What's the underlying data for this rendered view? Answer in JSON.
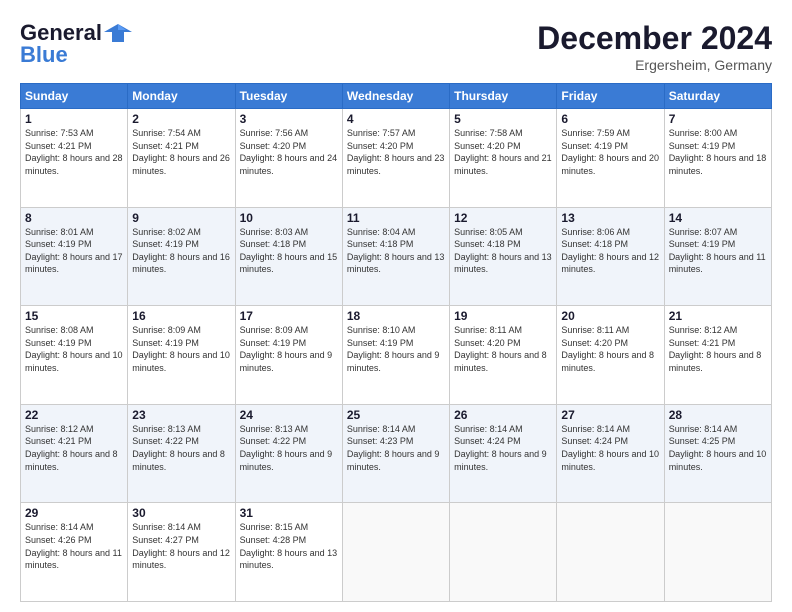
{
  "header": {
    "logo_line1": "General",
    "logo_line2": "Blue",
    "month_title": "December 2024",
    "location": "Ergersheim, Germany"
  },
  "days_of_week": [
    "Sunday",
    "Monday",
    "Tuesday",
    "Wednesday",
    "Thursday",
    "Friday",
    "Saturday"
  ],
  "weeks": [
    [
      {
        "day": "1",
        "sunrise": "7:53 AM",
        "sunset": "4:21 PM",
        "daylight": "8 hours and 28 minutes."
      },
      {
        "day": "2",
        "sunrise": "7:54 AM",
        "sunset": "4:21 PM",
        "daylight": "8 hours and 26 minutes."
      },
      {
        "day": "3",
        "sunrise": "7:56 AM",
        "sunset": "4:20 PM",
        "daylight": "8 hours and 24 minutes."
      },
      {
        "day": "4",
        "sunrise": "7:57 AM",
        "sunset": "4:20 PM",
        "daylight": "8 hours and 23 minutes."
      },
      {
        "day": "5",
        "sunrise": "7:58 AM",
        "sunset": "4:20 PM",
        "daylight": "8 hours and 21 minutes."
      },
      {
        "day": "6",
        "sunrise": "7:59 AM",
        "sunset": "4:19 PM",
        "daylight": "8 hours and 20 minutes."
      },
      {
        "day": "7",
        "sunrise": "8:00 AM",
        "sunset": "4:19 PM",
        "daylight": "8 hours and 18 minutes."
      }
    ],
    [
      {
        "day": "8",
        "sunrise": "8:01 AM",
        "sunset": "4:19 PM",
        "daylight": "8 hours and 17 minutes."
      },
      {
        "day": "9",
        "sunrise": "8:02 AM",
        "sunset": "4:19 PM",
        "daylight": "8 hours and 16 minutes."
      },
      {
        "day": "10",
        "sunrise": "8:03 AM",
        "sunset": "4:18 PM",
        "daylight": "8 hours and 15 minutes."
      },
      {
        "day": "11",
        "sunrise": "8:04 AM",
        "sunset": "4:18 PM",
        "daylight": "8 hours and 13 minutes."
      },
      {
        "day": "12",
        "sunrise": "8:05 AM",
        "sunset": "4:18 PM",
        "daylight": "8 hours and 13 minutes."
      },
      {
        "day": "13",
        "sunrise": "8:06 AM",
        "sunset": "4:18 PM",
        "daylight": "8 hours and 12 minutes."
      },
      {
        "day": "14",
        "sunrise": "8:07 AM",
        "sunset": "4:19 PM",
        "daylight": "8 hours and 11 minutes."
      }
    ],
    [
      {
        "day": "15",
        "sunrise": "8:08 AM",
        "sunset": "4:19 PM",
        "daylight": "8 hours and 10 minutes."
      },
      {
        "day": "16",
        "sunrise": "8:09 AM",
        "sunset": "4:19 PM",
        "daylight": "8 hours and 10 minutes."
      },
      {
        "day": "17",
        "sunrise": "8:09 AM",
        "sunset": "4:19 PM",
        "daylight": "8 hours and 9 minutes."
      },
      {
        "day": "18",
        "sunrise": "8:10 AM",
        "sunset": "4:19 PM",
        "daylight": "8 hours and 9 minutes."
      },
      {
        "day": "19",
        "sunrise": "8:11 AM",
        "sunset": "4:20 PM",
        "daylight": "8 hours and 8 minutes."
      },
      {
        "day": "20",
        "sunrise": "8:11 AM",
        "sunset": "4:20 PM",
        "daylight": "8 hours and 8 minutes."
      },
      {
        "day": "21",
        "sunrise": "8:12 AM",
        "sunset": "4:21 PM",
        "daylight": "8 hours and 8 minutes."
      }
    ],
    [
      {
        "day": "22",
        "sunrise": "8:12 AM",
        "sunset": "4:21 PM",
        "daylight": "8 hours and 8 minutes."
      },
      {
        "day": "23",
        "sunrise": "8:13 AM",
        "sunset": "4:22 PM",
        "daylight": "8 hours and 8 minutes."
      },
      {
        "day": "24",
        "sunrise": "8:13 AM",
        "sunset": "4:22 PM",
        "daylight": "8 hours and 9 minutes."
      },
      {
        "day": "25",
        "sunrise": "8:14 AM",
        "sunset": "4:23 PM",
        "daylight": "8 hours and 9 minutes."
      },
      {
        "day": "26",
        "sunrise": "8:14 AM",
        "sunset": "4:24 PM",
        "daylight": "8 hours and 9 minutes."
      },
      {
        "day": "27",
        "sunrise": "8:14 AM",
        "sunset": "4:24 PM",
        "daylight": "8 hours and 10 minutes."
      },
      {
        "day": "28",
        "sunrise": "8:14 AM",
        "sunset": "4:25 PM",
        "daylight": "8 hours and 10 minutes."
      }
    ],
    [
      {
        "day": "29",
        "sunrise": "8:14 AM",
        "sunset": "4:26 PM",
        "daylight": "8 hours and 11 minutes."
      },
      {
        "day": "30",
        "sunrise": "8:14 AM",
        "sunset": "4:27 PM",
        "daylight": "8 hours and 12 minutes."
      },
      {
        "day": "31",
        "sunrise": "8:15 AM",
        "sunset": "4:28 PM",
        "daylight": "8 hours and 13 minutes."
      },
      null,
      null,
      null,
      null
    ]
  ]
}
